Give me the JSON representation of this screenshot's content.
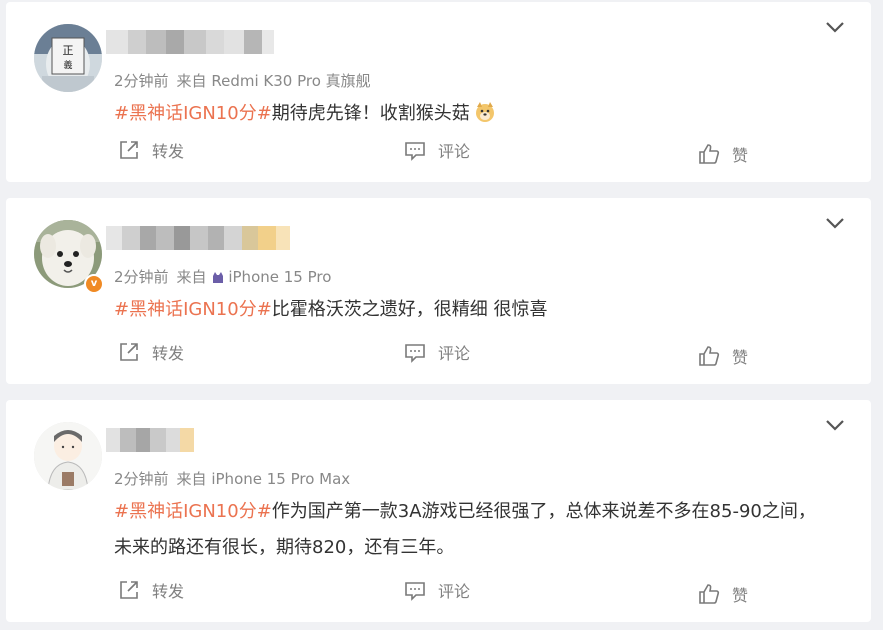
{
  "posts": [
    {
      "time": "2分钟前",
      "source_prefix": "来自",
      "source": "Redmi K30 Pro 真旗舰",
      "tag": "#黑神话IGN10分#",
      "text": "期待虎先锋！收割猴头菇",
      "text_line2": "",
      "avatar_text": "正义",
      "verified": false
    },
    {
      "time": "2分钟前",
      "source_prefix": "来自",
      "source": "iPhone 15 Pro",
      "tag": "#黑神话IGN10分#",
      "text": "比霍格沃茨之遗好，很精细 很惊喜",
      "text_line2": "",
      "verified": true,
      "verified_mark": "v"
    },
    {
      "time": "2分钟前",
      "source_prefix": "来自",
      "source": "iPhone 15 Pro Max",
      "tag": "#黑神话IGN10分#",
      "text": "作为国产第一款3A游戏已经很强了，总体来说差不多在85-90之间，",
      "text_line2": "未来的路还有很长，期待820，还有三年。",
      "verified": false
    }
  ],
  "actions": {
    "repost": "转发",
    "comment": "评论",
    "like": "赞"
  },
  "colors": {
    "hashtag": "#eb7350",
    "meta": "#888888",
    "background": "#f0f1f4",
    "verified_badge": "#f08a24"
  }
}
